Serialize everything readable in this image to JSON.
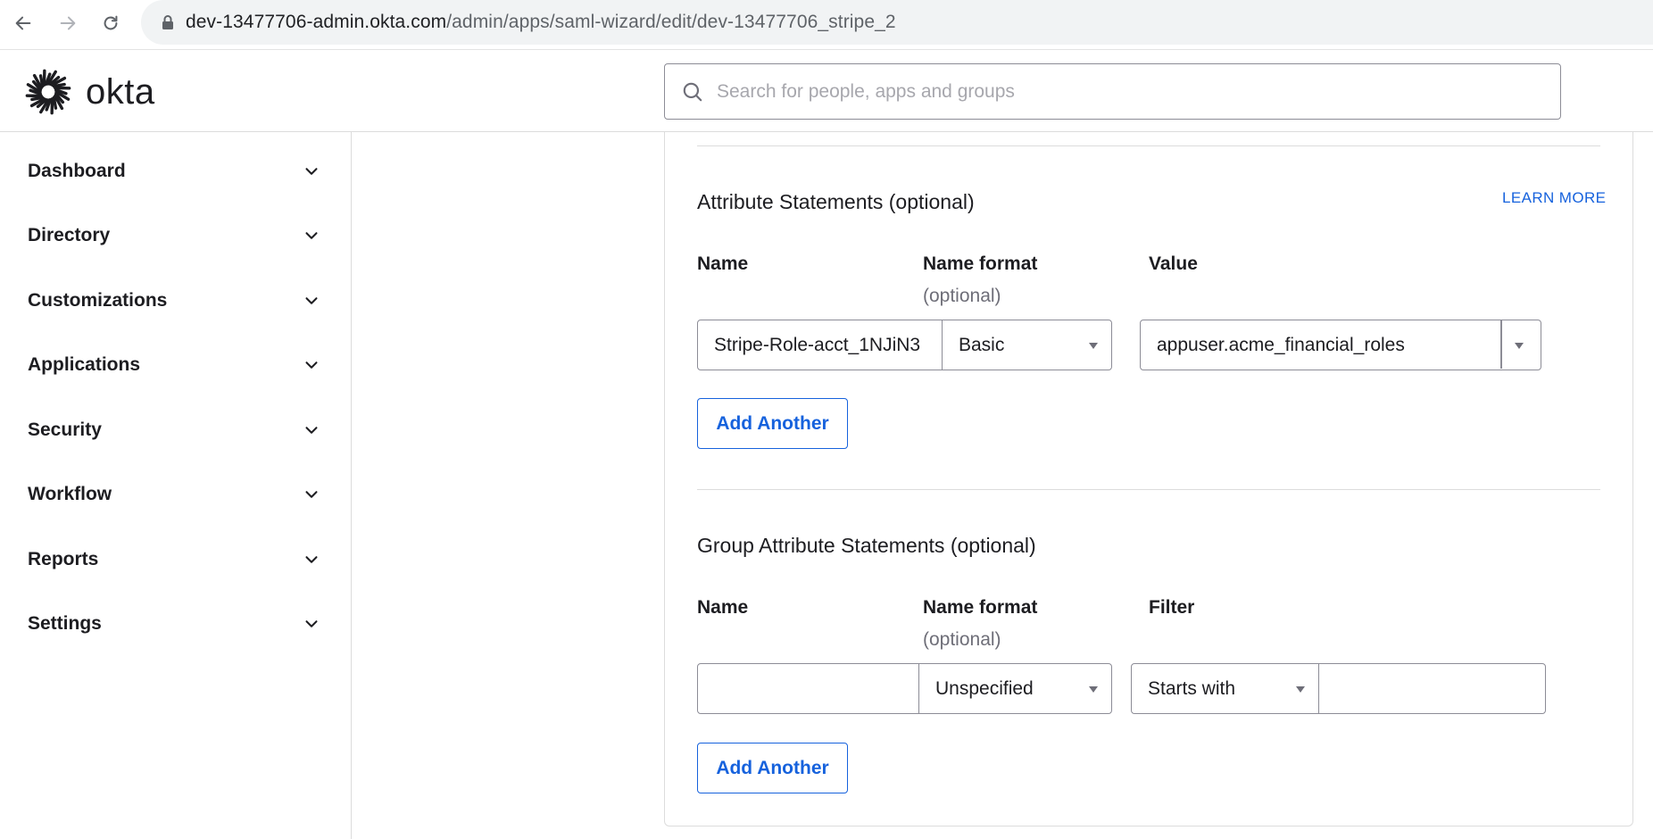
{
  "browser": {
    "url_host": "dev-13477706-admin.okta.com",
    "url_path": "/admin/apps/saml-wizard/edit/dev-13477706_stripe_2"
  },
  "header": {
    "logo_text": "okta",
    "search_placeholder": "Search for people, apps and groups"
  },
  "sidebar": {
    "items": [
      {
        "label": "Dashboard"
      },
      {
        "label": "Directory"
      },
      {
        "label": "Customizations"
      },
      {
        "label": "Applications"
      },
      {
        "label": "Security"
      },
      {
        "label": "Workflow"
      },
      {
        "label": "Reports"
      },
      {
        "label": "Settings"
      }
    ]
  },
  "attribute_statements": {
    "title": "Attribute Statements (optional)",
    "learn_more": "LEARN MORE",
    "col_name": "Name",
    "col_format": "Name format",
    "col_format_sub": "(optional)",
    "col_value": "Value",
    "row": {
      "name": "Stripe-Role-acct_1NJiN3",
      "format": "Basic",
      "value": "appuser.acme_financial_roles"
    },
    "add_label": "Add Another"
  },
  "group_attribute_statements": {
    "title": "Group Attribute Statements (optional)",
    "col_name": "Name",
    "col_format": "Name format",
    "col_format_sub": "(optional)",
    "col_filter": "Filter",
    "row": {
      "name": "",
      "format": "Unspecified",
      "filter_type": "Starts with",
      "filter_value": ""
    },
    "add_label": "Add Another"
  },
  "colors": {
    "link": "#1662dd",
    "border": "#8c8c96",
    "divider": "#dcdcdc"
  }
}
